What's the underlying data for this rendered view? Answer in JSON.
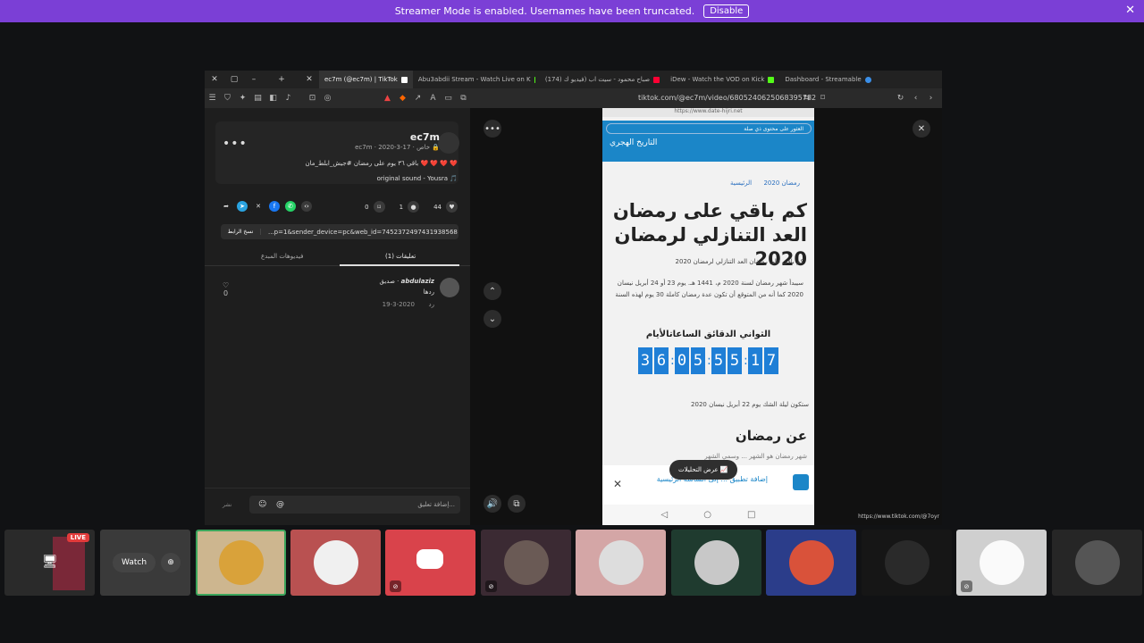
{
  "banner": {
    "text": "Streamer Mode is enabled. Usernames have been truncated.",
    "disable_label": "Disable",
    "bg": "#7b3fd6"
  },
  "browser": {
    "tabs": [
      {
        "label": "ec7m (@ec7m) | TikTok",
        "active": true
      },
      {
        "label": "Abu3abdii Stream - Watch Live on K",
        "active": false
      },
      {
        "label": "(174) صباح محمود - سيت اب (فيديو ك",
        "active": false
      },
      {
        "label": "iDew - Watch the VOD on Kick",
        "active": false
      },
      {
        "label": "Dashboard - Streamable",
        "active": false
      }
    ],
    "url": "tiktok.com/@ec7m/video/6805240625068395782"
  },
  "post": {
    "username": "ec7m",
    "subline": "ec7m · 2020-3-17 · خاص 🔒",
    "caption": "باقي ٣٦ يوم على رمضان #جيش_ابلط_مان ❤️ ❤️ ❤️ ❤️",
    "sound": "original sound - Yousra 🎵",
    "likes": "44",
    "comments_count": "1",
    "saves": "0",
    "link_text": "...p=1&sender_device=pc&web_id=7452372497431938568",
    "copy_link_label": "نسخ الرابط",
    "tab_comments": "تعليقات (1)",
    "tab_creator_videos": "فيديوهات المبدع"
  },
  "comment": {
    "user": "abdulaziz",
    "user_suffix": "صديق ·",
    "text": "ردها",
    "date": "2020-3-19",
    "reply": "رد",
    "likes": "0"
  },
  "input": {
    "placeholder": "إضافة تعليق...",
    "send_label": "نشر"
  },
  "phone": {
    "top_url": "https://www.date-hijri.net",
    "search_placeholder": "العثور على محتوى ذي صلة",
    "logo_text": "التاريخ الهجري",
    "breadcrumb_home": "الرئيسية",
    "breadcrumb_current": "رمضان 2020",
    "title": "كم باقي على رمضان العد التنازلي لرمضان 2020",
    "subtitle": "كم باقي على رمضان العد التنازلي لرمضان 2020",
    "paragraph": "سيبدأ شهر رمضان لسنة 2020 م، 1441 هـ. يوم 23 أو 24 أبريل نيسان 2020 كما أنه من المتوقع أن تكون عدة رمضان كاملة 30 يوم لهذه السنة",
    "counter_labels": "الثواني الدقائق الساعاتالأيام",
    "counter_digits": [
      "3",
      "6",
      ":",
      "0",
      "5",
      ":",
      "5",
      "5",
      ":",
      "1",
      "7"
    ],
    "note": "ستكون ليلة الشك يوم 22 أبريل نيسان 2020",
    "heading2": "عن رمضان",
    "line": "شهر رمضان هو الشهر ... وسمي الشهر",
    "promo": "إضافة تطبيق ... إلى الشاشة الرئيسية",
    "pill": "عرض التحليلات"
  },
  "tiktok_link": "https://www.tiktok.com/@7oyr",
  "strip": {
    "watch_label": "Watch",
    "live_label": "LIVE",
    "tiles": [
      {
        "name": "stream-preview",
        "bg": "#2a2a2a"
      },
      {
        "name": "watch-tile",
        "bg": "#3a3a3a"
      },
      {
        "name": "participant-1",
        "bg": "#cdb68f",
        "avatar": "#d9a23a",
        "speaking": true
      },
      {
        "name": "participant-2",
        "bg": "#b95151",
        "avatar": "#f0f0f0"
      },
      {
        "name": "participant-discord",
        "bg": "#d9434b",
        "muted": true
      },
      {
        "name": "participant-4",
        "bg": "#3b2a33",
        "avatar": "#6a5a55",
        "muted": true
      },
      {
        "name": "participant-5",
        "bg": "#d4a6a6",
        "avatar": "#ddd"
      },
      {
        "name": "participant-6",
        "bg": "#1f3b2f",
        "avatar": "#c8c8c8"
      },
      {
        "name": "participant-7",
        "bg": "#2b3d8a",
        "avatar": "#d9523a"
      },
      {
        "name": "participant-8",
        "bg": "#161616",
        "avatar": "#2a2a2a"
      },
      {
        "name": "participant-9",
        "bg": "#cfcfcf",
        "avatar": "#fafafa",
        "muted": true
      },
      {
        "name": "participant-10",
        "bg": "#262626",
        "avatar": "#555"
      }
    ]
  }
}
